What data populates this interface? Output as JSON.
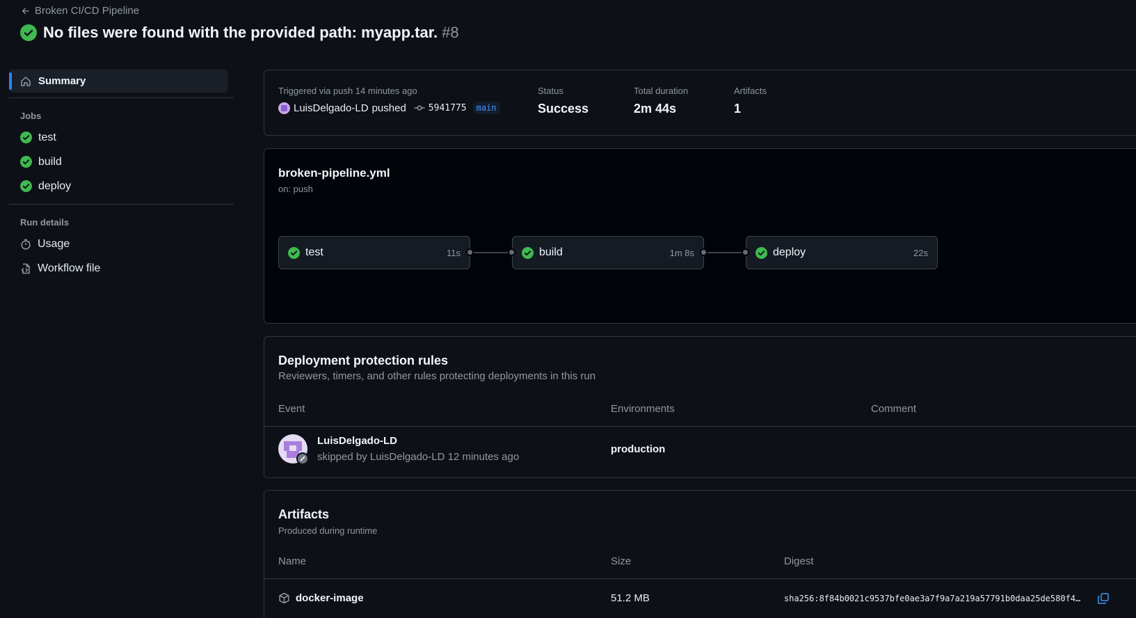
{
  "header": {
    "back_label": "Broken CI/CD Pipeline",
    "title": "No files were found with the provided path: myapp.tar.",
    "run_number": "#8"
  },
  "sidebar": {
    "summary_label": "Summary",
    "jobs_heading": "Jobs",
    "jobs": [
      {
        "label": "test",
        "icon": "check-circle-icon"
      },
      {
        "label": "build",
        "icon": "check-circle-icon"
      },
      {
        "label": "deploy",
        "icon": "check-circle-icon"
      }
    ],
    "run_details_heading": "Run details",
    "run_details": [
      {
        "label": "Usage",
        "icon": "stopwatch-icon"
      },
      {
        "label": "Workflow file",
        "icon": "workflow-file-icon"
      }
    ]
  },
  "summary": {
    "triggered_label": "Triggered via push 14 minutes ago",
    "actor": "LuisDelgado-LD",
    "action": "pushed",
    "commit_sha": "5941775",
    "branch": "main",
    "status_label": "Status",
    "status_value": "Success",
    "duration_label": "Total duration",
    "duration_value": "2m 44s",
    "artifacts_label": "Artifacts",
    "artifacts_value": "1"
  },
  "workflow_graph": {
    "file_name": "broken-pipeline.yml",
    "trigger": "on: push",
    "jobs": [
      {
        "name": "test",
        "duration": "11s"
      },
      {
        "name": "build",
        "duration": "1m 8s"
      },
      {
        "name": "deploy",
        "duration": "22s"
      }
    ]
  },
  "deployment_rules": {
    "title": "Deployment protection rules",
    "subtitle": "Reviewers, timers, and other rules protecting deployments in this run",
    "columns": [
      "Event",
      "Environments",
      "Comment"
    ],
    "row": {
      "user": "LuisDelgado-LD",
      "detail": "skipped by LuisDelgado-LD 12 minutes ago",
      "environment": "production",
      "comment": ""
    }
  },
  "artifacts": {
    "title": "Artifacts",
    "subtitle": "Produced during runtime",
    "columns": [
      "Name",
      "Size",
      "Digest"
    ],
    "row": {
      "name": "docker-image",
      "size": "51.2 MB",
      "digest": "sha256:8f84b0021c9537bfe0ae3a7f9a7a219a57791b0daa25de580f4…"
    }
  },
  "colors": {
    "success": "#3fb950",
    "accent": "#2f81f7",
    "background": "#0d1117",
    "graph_background": "#010409"
  }
}
